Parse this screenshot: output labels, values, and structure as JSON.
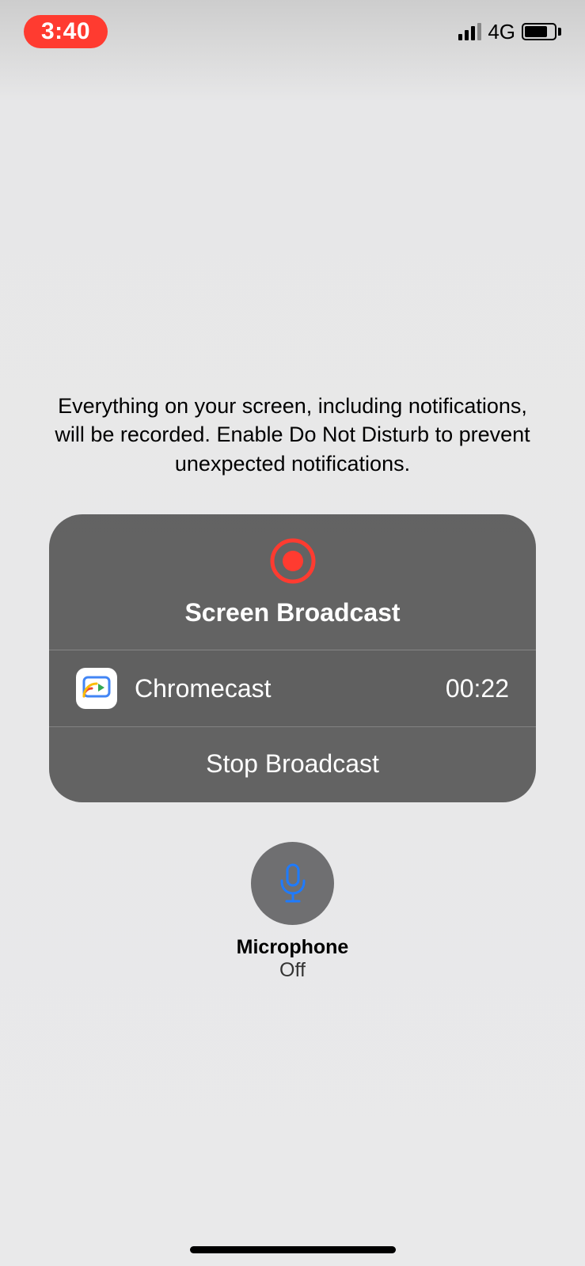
{
  "status": {
    "time": "3:40",
    "network": "4G"
  },
  "info": "Everything on your screen, including notifications, will be recorded. Enable Do Not Disturb to prevent unexpected notifications.",
  "panel": {
    "title": "Screen Broadcast",
    "app_name": "Chromecast",
    "elapsed": "00:22",
    "stop_label": "Stop Broadcast"
  },
  "mic": {
    "label": "Microphone",
    "state": "Off"
  }
}
